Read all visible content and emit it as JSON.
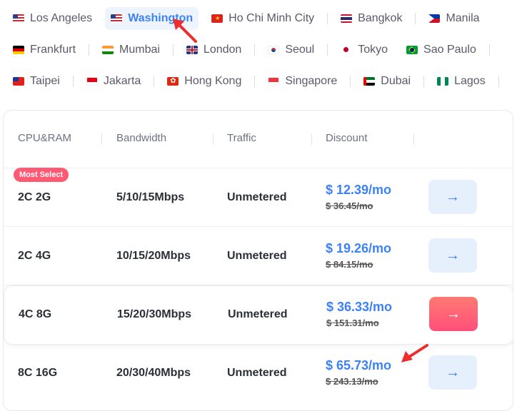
{
  "locations": {
    "rows": [
      [
        {
          "label": "Los Angeles",
          "flag": "us"
        },
        {
          "label": "Washington",
          "flag": "us",
          "active": true
        },
        {
          "label": "Ho Chi Minh City",
          "flag": "vn"
        },
        {
          "label": "Bangkok",
          "flag": "th"
        },
        {
          "label": "Manila",
          "flag": "ph"
        }
      ],
      [
        {
          "label": "Frankfurt",
          "flag": "de"
        },
        {
          "label": "Mumbai",
          "flag": "in"
        },
        {
          "label": "London",
          "flag": "gb"
        },
        {
          "label": "Seoul",
          "flag": "kr"
        },
        {
          "label": "Tokyo",
          "flag": "jp"
        },
        {
          "label": "Sao Paulo",
          "flag": "br"
        }
      ],
      [
        {
          "label": "Taipei",
          "flag": "tw"
        },
        {
          "label": "Jakarta",
          "flag": "id"
        },
        {
          "label": "Hong Kong",
          "flag": "hk"
        },
        {
          "label": "Singapore",
          "flag": "sg"
        },
        {
          "label": "Dubai",
          "flag": "ae"
        },
        {
          "label": "Lagos",
          "flag": "ng"
        }
      ]
    ]
  },
  "table": {
    "headers": [
      "CPU&RAM",
      "Bandwidth",
      "Traffic",
      "Discount"
    ],
    "badge": "Most Select",
    "rows": [
      {
        "cpu": "2C 2G",
        "bandwidth": "5/10/15Mbps",
        "traffic": "Unmetered",
        "price": "$ 12.39/mo",
        "old_price": "$ 36.45/mo"
      },
      {
        "cpu": "2C 4G",
        "bandwidth": "10/15/20Mbps",
        "traffic": "Unmetered",
        "price": "$ 19.26/mo",
        "old_price": "$ 84.15/mo"
      },
      {
        "cpu": "4C 8G",
        "bandwidth": "15/20/30Mbps",
        "traffic": "Unmetered",
        "price": "$ 36.33/mo",
        "old_price": "$ 151.31/mo",
        "featured": true
      },
      {
        "cpu": "8C 16G",
        "bandwidth": "20/30/40Mbps",
        "traffic": "Unmetered",
        "price": "$ 65.73/mo",
        "old_price": "$ 243.13/mo"
      }
    ]
  },
  "colors": {
    "accent": "#3b82f6",
    "hot": "#ff5a74",
    "annotation": "#ee2d2d"
  },
  "icons": {
    "go": "arrow-right-icon"
  }
}
